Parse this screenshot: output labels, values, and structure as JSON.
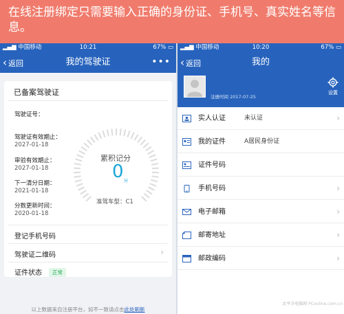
{
  "banner": {
    "text": "在线注册绑定只需要输入正确的身份证、手机号、真实姓名等信息。"
  },
  "left_phone": {
    "status": {
      "carrier": "中国移动",
      "time": "10:21",
      "battery": "67%"
    },
    "nav": {
      "back": "返回",
      "title": "我的驾驶证",
      "more": "•••"
    },
    "card_title": "已备案驾驶证",
    "fields": [
      {
        "label": "驾驶证号：",
        "value": ""
      },
      {
        "label": "驾驶证有效期止：",
        "value": "2027-01-18"
      },
      {
        "label": "审验有效期止：",
        "value": "2027-01-18"
      },
      {
        "label": "下一清分日期：",
        "value": "2021-01-18"
      },
      {
        "label": "分数更新时间：",
        "value": "2020-01-18"
      }
    ],
    "score": {
      "label": "累积记分",
      "value": "0",
      "unit": "分",
      "vehicle_type": "准驾车型：C1"
    },
    "rows": [
      {
        "label": "登记手机号码"
      },
      {
        "label": "驾驶证二维码"
      },
      {
        "label": "证件状态",
        "badge": "正常"
      }
    ],
    "footnote": {
      "text": "以上数据来自注册平台，如不一致请点击",
      "link": "此处刷新"
    }
  },
  "right_phone": {
    "status": {
      "carrier": "中国移动",
      "time": "10:20",
      "battery": "67%"
    },
    "nav": {
      "back": "返回",
      "title": "我的"
    },
    "profile": {
      "reg_time": "注册时间 2017-07-25",
      "settings_label": "设置"
    },
    "items": [
      {
        "label": "实人认证",
        "value": "未认证",
        "icon": "id-card-icon"
      },
      {
        "label": "我的证件",
        "value": "A居民身份证",
        "icon": "certificate-icon"
      },
      {
        "label": "证件号码",
        "value": "",
        "icon": "document-number-icon"
      },
      {
        "label": "手机号码",
        "value": "",
        "icon": "phone-icon"
      },
      {
        "label": "电子邮箱",
        "value": "",
        "icon": "mail-icon"
      },
      {
        "label": "邮寄地址",
        "value": "",
        "icon": "address-icon"
      },
      {
        "label": "邮政编码",
        "value": "",
        "icon": "postcode-icon"
      }
    ],
    "watermark": "太平洋电脑网 PConline.com.cn"
  },
  "colors": {
    "nav_blue": "#2763bd",
    "banner": "#f07b6c",
    "score": "#1aa7d8",
    "badge_green": "#2aa85a"
  }
}
